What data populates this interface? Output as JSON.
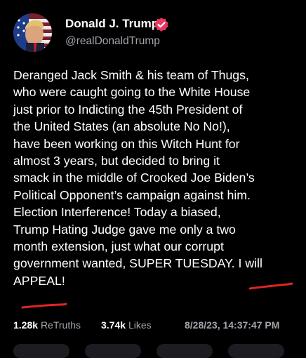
{
  "author": {
    "display_name": "Donald J. Trump",
    "handle": "@realDonaldTrump",
    "verified_icon": "verified-badge-icon",
    "avatar_icon": "profile-avatar"
  },
  "post": {
    "lines": [
      "Deranged Jack Smith & his team of Thugs,",
      "who were caught going to the White House",
      "just prior to Indicting the 45th President of",
      "the United States (an absolute No No!),",
      "have been working on this Witch Hunt for",
      "almost 3 years, but decided to bring it",
      "smack in the middle of Crooked Joe Biden’s",
      "Political Opponent’s campaign against him.",
      "Election Interference! Today a biased,",
      "Trump Hating Judge gave me only a two",
      "month extension, just what our corrupt",
      "government wanted, SUPER TUESDAY. I will",
      "APPEAL!"
    ]
  },
  "stats": {
    "retruths_count": "1.28k",
    "retruths_label": "ReTruths",
    "likes_count": "3.74k",
    "likes_label": "Likes",
    "timestamp": "8/28/23, 14:37:47 PM"
  },
  "colors": {
    "background": "#000000",
    "verified": "#e8385f",
    "annotation": "#e02424",
    "muted": "#a3a5ad"
  }
}
